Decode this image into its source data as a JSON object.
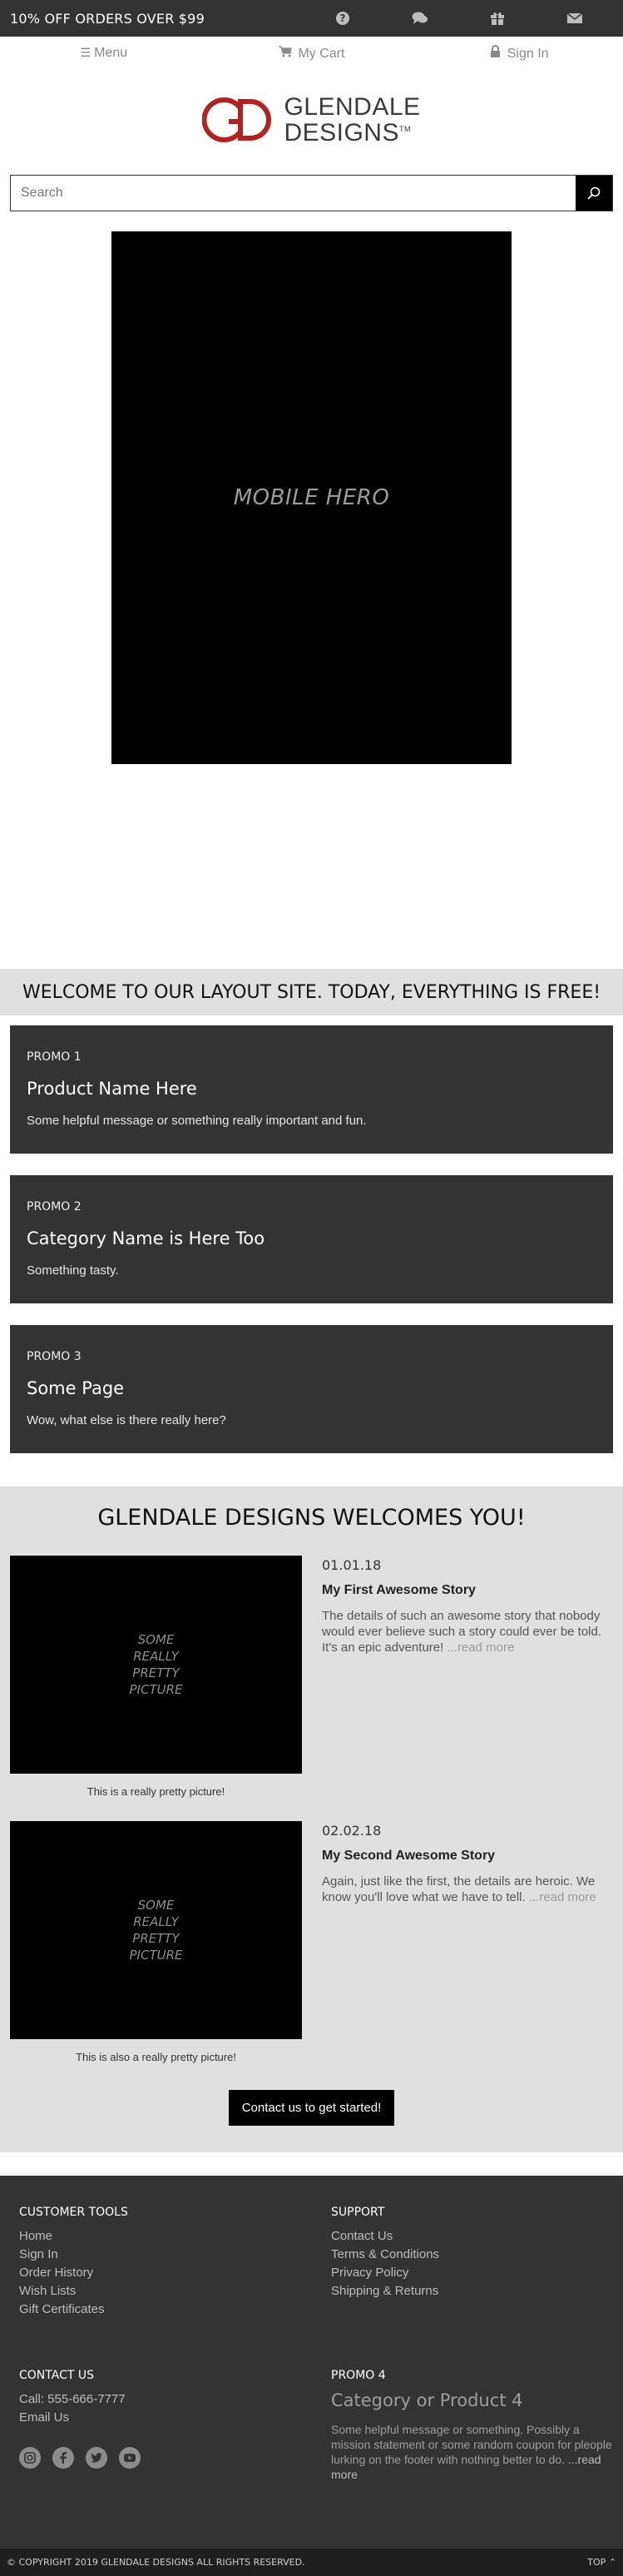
{
  "topbar": {
    "promo_text": "10% OFF ORDERS OVER $99",
    "icons": [
      "help-icon",
      "chat-icon",
      "gift-icon",
      "mail-icon"
    ]
  },
  "nav": {
    "menu_label": "Menu",
    "cart_label": "My Cart",
    "signin_label": "Sign In"
  },
  "logo": {
    "line1": "GLENDALE",
    "line2": "DESIGNS",
    "tm": "TM",
    "brand_color": "#b22222"
  },
  "search": {
    "placeholder": "Search"
  },
  "hero": {
    "text": "MOBILE HERO"
  },
  "welcome": {
    "text": "WELCOME TO OUR LAYOUT SITE. TODAY, EVERYTHING IS FREE!"
  },
  "promos": [
    {
      "label": "PROMO 1",
      "title": "Product Name Here",
      "desc": "Some helpful message or something really important and fun."
    },
    {
      "label": "PROMO 2",
      "title": "Category Name is Here Too",
      "desc": "Something tasty."
    },
    {
      "label": "PROMO 3",
      "title": "Some Page",
      "desc": "Wow, what else is there really here?"
    }
  ],
  "stories": {
    "heading": "GLENDALE DESIGNS WELCOMES YOU!",
    "items": [
      {
        "picture_text": "SOME REALLY PRETTY PICTURE",
        "caption": "This is a really pretty picture!",
        "date": "01.01.18",
        "title": "My First Awesome Story",
        "body": "The details of such an awesome story that nobody would ever believe such a story could ever be told. It's an epic adventure!",
        "more": " ...read more"
      },
      {
        "picture_text": "SOME REALLY PRETTY PICTURE",
        "caption": "This is also a really pretty picture!",
        "date": "02.02.18",
        "title": "My Second Awesome Story",
        "body": "Again, just like the first, the details are heroic. We know you'll love what we have to tell.",
        "more": " ...read more"
      }
    ],
    "cta_label": "Contact us to get started!"
  },
  "footer": {
    "customer_tools": {
      "heading": "CUSTOMER TOOLS",
      "links": [
        "Home",
        "Sign In",
        "Order History",
        "Wish Lists",
        "Gift Certificates"
      ]
    },
    "support": {
      "heading": "SUPPORT",
      "links": [
        "Contact Us",
        "Terms & Conditions",
        "Privacy Policy",
        "Shipping & Returns"
      ]
    },
    "contact": {
      "heading": "CONTACT US",
      "phone": "Call: 555-666-7777",
      "email": "Email Us",
      "socials": [
        "instagram-icon",
        "facebook-icon",
        "twitter-icon",
        "youtube-icon"
      ]
    },
    "promo4": {
      "heading": "PROMO 4",
      "title": "Category or Product 4",
      "desc": "Some helpful message or something. Possibly a mission statement or some random coupon for pleople lurking on the footer with nothing better to do.",
      "more": " ...read more"
    }
  },
  "bottombar": {
    "copyright": "© COPYRIGHT 2019 GLENDALE DESIGNS ALL RIGHTS RESERVED.",
    "top_label": "TOP"
  }
}
